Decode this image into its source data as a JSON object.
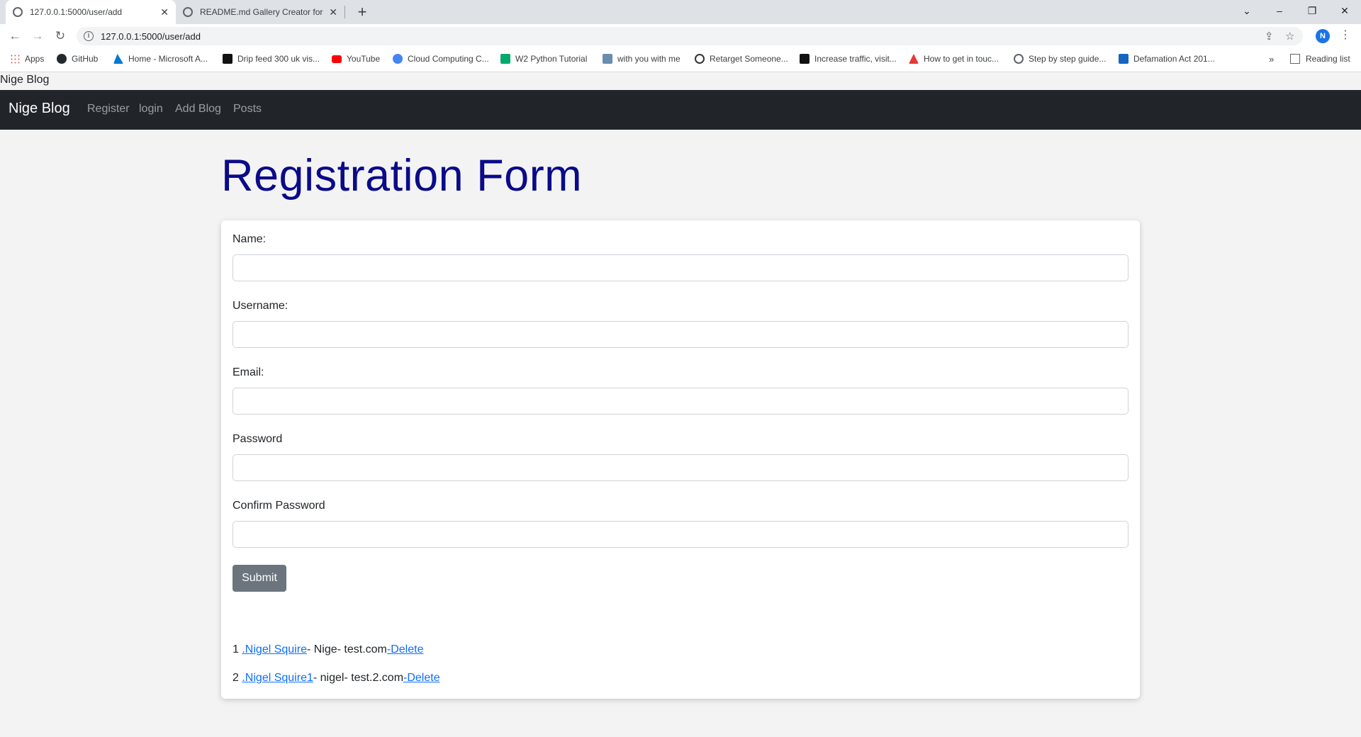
{
  "browser": {
    "tabs": [
      {
        "title": "127.0.0.1:5000/user/add",
        "active": true
      },
      {
        "title": "README.md Gallery Creator for (",
        "active": false
      }
    ],
    "new_tab": "+",
    "window_controls": {
      "tab_search": "⌄",
      "minimize": "–",
      "restore": "❐",
      "close": "✕"
    },
    "url": "127.0.0.1:5000/user/add",
    "profile_initial": "N",
    "bookmarks": [
      {
        "label": "Apps",
        "icon": "apps-grid-icon",
        "color": "#ea4335"
      },
      {
        "label": "GitHub",
        "icon": "github-icon",
        "color": "#24292e"
      },
      {
        "label": "Home - Microsoft A...",
        "icon": "azure-icon",
        "color": "#0078d4"
      },
      {
        "label": "Drip feed 300 uk vis...",
        "icon": "f-logo-icon",
        "color": "#111111"
      },
      {
        "label": "YouTube",
        "icon": "youtube-icon",
        "color": "#ff0000"
      },
      {
        "label": "Cloud Computing C...",
        "icon": "cloud-icon",
        "color": "#4285f4"
      },
      {
        "label": "W2 Python Tutorial",
        "icon": "w3-icon",
        "color": "#04aa6d"
      },
      {
        "label": "with you with me",
        "icon": "site-icon",
        "color": "#6a8caf"
      },
      {
        "label": "Retarget Someone...",
        "icon": "target-icon",
        "color": "#333333"
      },
      {
        "label": "Increase traffic, visit...",
        "icon": "f-logo-icon",
        "color": "#111111"
      },
      {
        "label": "How to get in touc...",
        "icon": "arrow-logo-icon",
        "color": "#e53935"
      },
      {
        "label": "Step by step guide...",
        "icon": "globe-icon",
        "color": "#5f6368"
      },
      {
        "label": "Defamation Act 201...",
        "icon": "wordpress-icon",
        "color": "#1565c0"
      }
    ],
    "bookmarks_more": "»",
    "reading_list": "Reading list"
  },
  "page": {
    "top_text": "Nige Blog",
    "navbar": {
      "brand": "Nige Blog",
      "links": [
        "Register",
        "login",
        "Add Blog",
        "Posts"
      ]
    },
    "heading": "Registration Form",
    "form": {
      "fields": [
        {
          "label": "Name:",
          "value": ""
        },
        {
          "label": "Username:",
          "value": ""
        },
        {
          "label": "Email:",
          "value": ""
        },
        {
          "label": "Password",
          "value": ""
        },
        {
          "label": "Confirm Password",
          "value": ""
        }
      ],
      "submit_label": "Submit"
    },
    "users": [
      {
        "num": "1",
        "name": ".Nigel Squire",
        "middle": "- Nige- test.com",
        "delete": "-Delete"
      },
      {
        "num": "2",
        "name": ".Nigel Squire1",
        "middle": "- nigel- test.2.com",
        "delete": "-Delete"
      }
    ]
  }
}
